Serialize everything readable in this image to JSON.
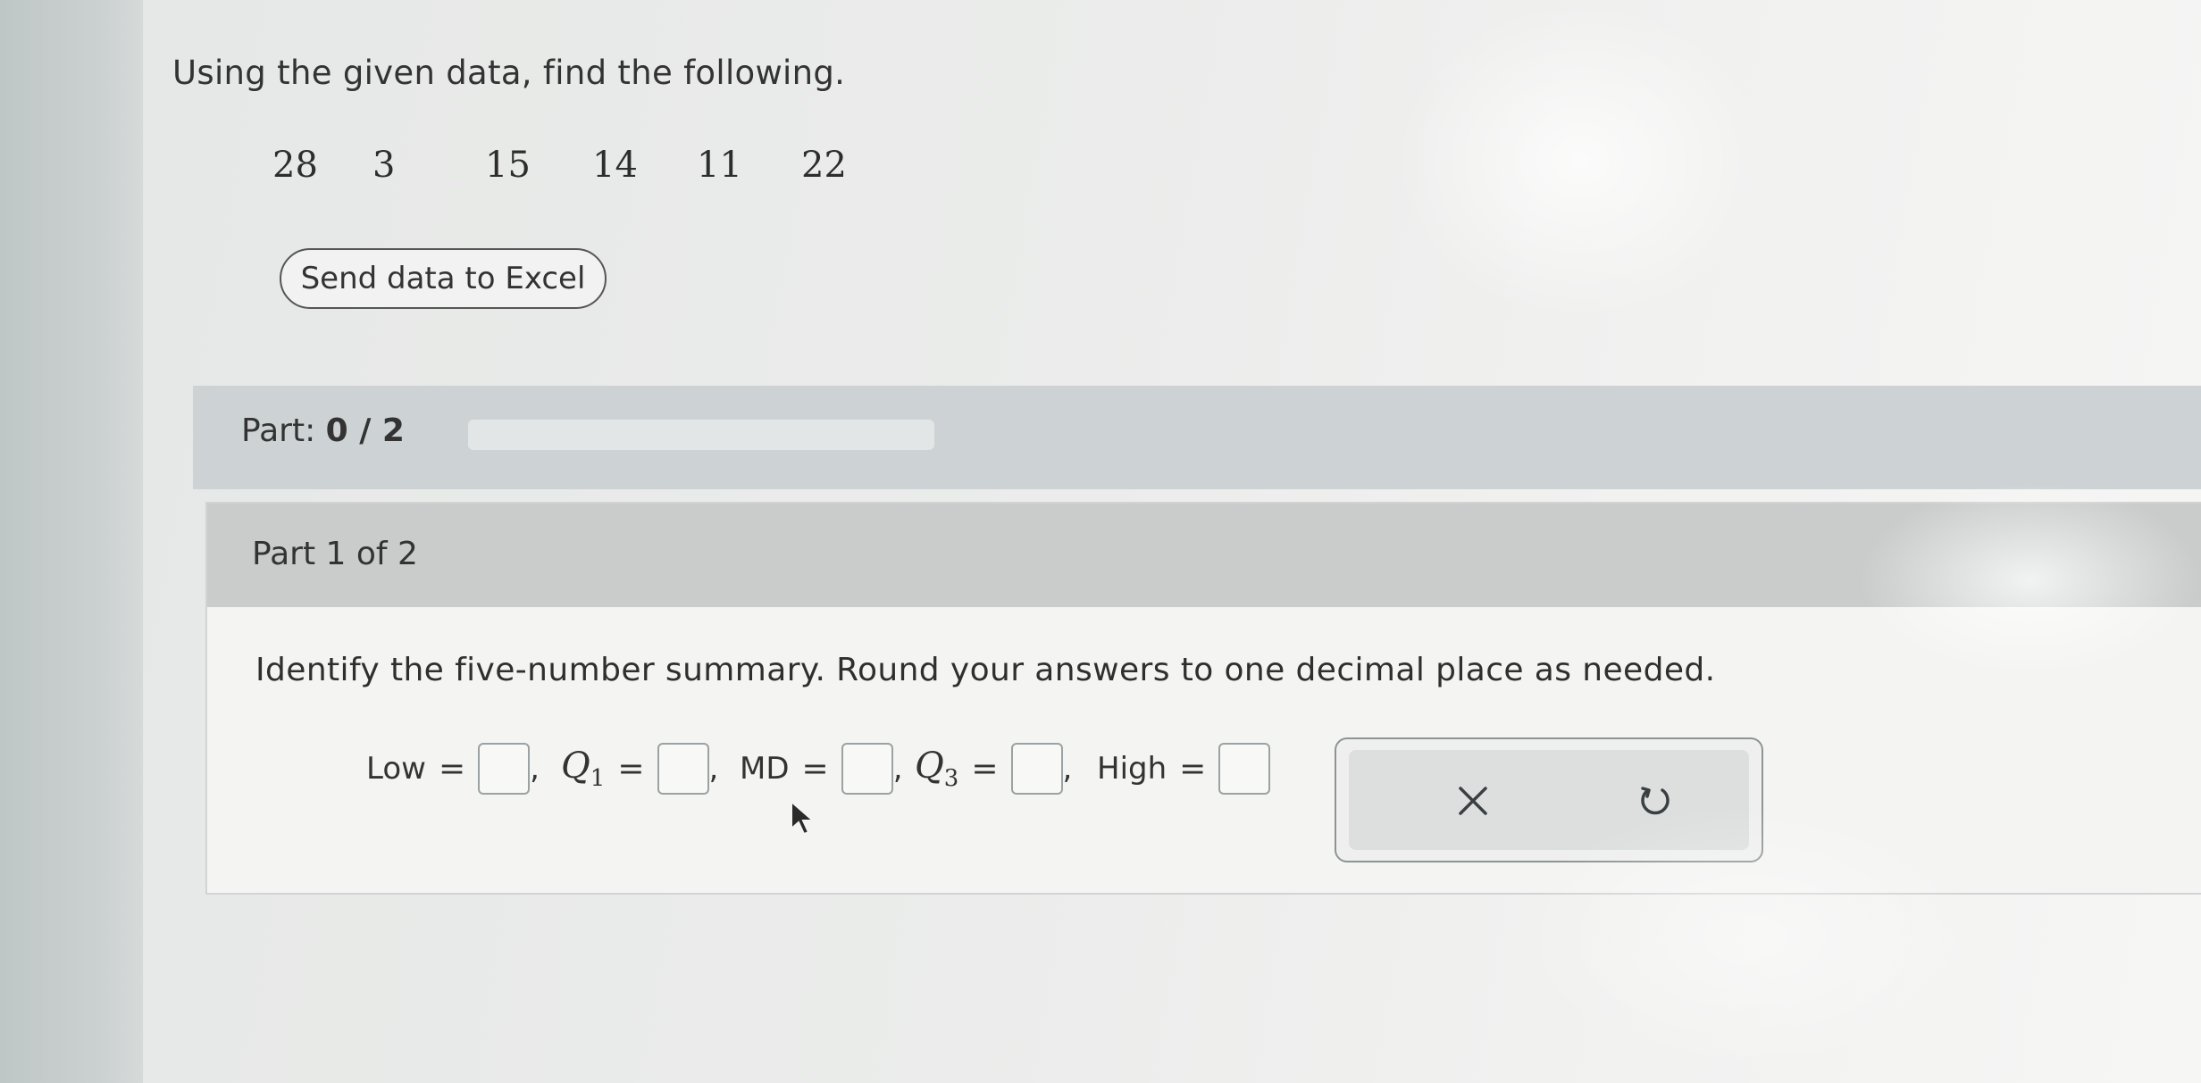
{
  "prompt": "Using the given data, find the following.",
  "data_values": [
    "28",
    "3",
    "15",
    "14",
    "11",
    "22"
  ],
  "excel_button_label": "Send data to Excel",
  "part_progress": {
    "label": "Part:",
    "value": "0 / 2",
    "completed_fraction": 0
  },
  "part_header": "Part 1 of 2",
  "question": "Identify the five-number summary. Round your answers to one decimal place as needed.",
  "summary": {
    "low_label": "Low",
    "q1_label": "Q",
    "q1_sub": "1",
    "md_label": "MD",
    "q3_label": "Q",
    "q3_sub": "3",
    "high_label": "High",
    "equals": "=",
    "separator": ","
  },
  "actions": {
    "clear_icon": "close-icon",
    "undo_icon": "undo-icon"
  },
  "colors": {
    "part_bar": "#cdd3d4",
    "card_header": "#c9cccb",
    "input_border": "#9aa2a3"
  }
}
